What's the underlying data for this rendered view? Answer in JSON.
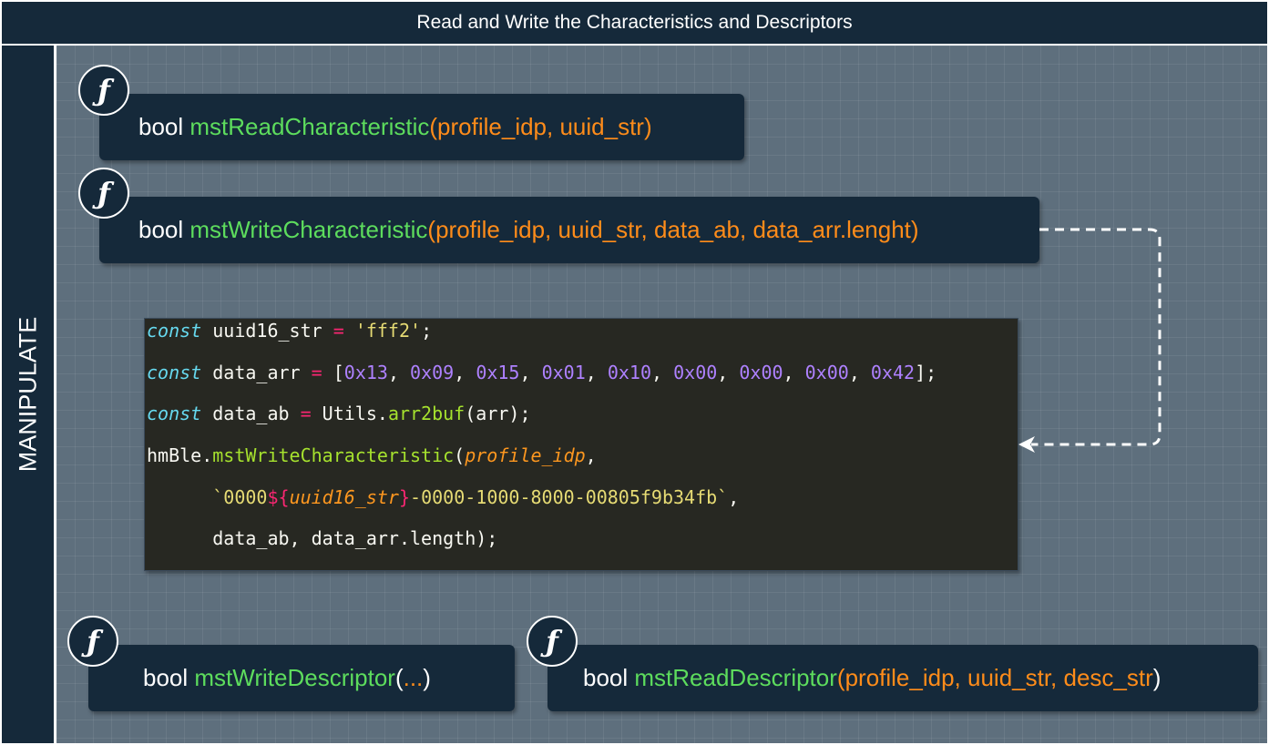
{
  "header": {
    "title": "Read and Write the Characteristics and Descriptors"
  },
  "sidebar": {
    "label": "MANIPULATE"
  },
  "icon_glyph": "ƒ",
  "functions": {
    "read_characteristic": {
      "type": "bool",
      "name": "mstReadCharacteristic",
      "open": "(",
      "params": "profile_idp, uuid_str",
      "close": ")"
    },
    "write_characteristic": {
      "type": "bool",
      "name": "mstWriteCharacteristic",
      "open": "(",
      "params": "profile_idp, uuid_str, data_ab, data_arr.lenght",
      "close": ")"
    },
    "write_descriptor": {
      "type": "bool",
      "name": "mstWriteDescriptor",
      "open": "(",
      "params": "...",
      "close": ")"
    },
    "read_descriptor": {
      "type": "bool",
      "name": "mstReadDescriptor",
      "open": "(",
      "params": "profile_idp, uuid_str, desc_str",
      "close": ")"
    }
  },
  "code": {
    "line1": {
      "kw": "const",
      "var": " uuid16_str ",
      "op": "=",
      "sp": " ",
      "str": "'fff2'",
      "end": ";"
    },
    "line2": {
      "kw": "const",
      "var": " data_arr ",
      "op": "=",
      "open": " [",
      "nums": [
        "0x13",
        "0x09",
        "0x15",
        "0x01",
        "0x10",
        "0x00",
        "0x00",
        "0x00",
        "0x42"
      ],
      "close": "];"
    },
    "line3": {
      "kw": "const",
      "var": " data_ab ",
      "op": "=",
      "obj": " Utils.",
      "fn": "arr2buf",
      "args": "(arr);"
    },
    "line4": {
      "obj": "hmBle.",
      "fn": "mstWriteCharacteristic",
      "open": "(",
      "param": "profile_idp",
      "end": ","
    },
    "line5": {
      "indent": "      ",
      "str_start": "`0000",
      "interp_open": "${",
      "interp_var": "uuid16_str",
      "interp_close": "}",
      "str_end": "-0000-1000-8000-00805f9b34fb`",
      "end": ","
    },
    "line6": {
      "indent": "      ",
      "text": "data_ab, data_arr.length);"
    }
  },
  "colors": {
    "panel": "#15293a",
    "canvas": "#5e6f7d",
    "fn_name": "#5ddc5d",
    "fn_params": "#ff8c1a",
    "code_bg": "#272822"
  }
}
